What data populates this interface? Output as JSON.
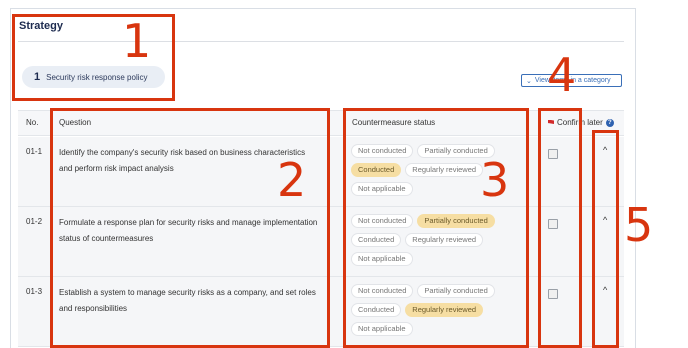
{
  "section": {
    "title": "Strategy"
  },
  "category": {
    "number": "1",
    "name": "Security risk response policy"
  },
  "view_category_button": "View items in a category",
  "table": {
    "headers": {
      "no": "No.",
      "question": "Question",
      "status": "Countermeasure status",
      "confirm": "Confirm later"
    },
    "rows": [
      {
        "no": "01-1",
        "question": "Identify the company's security risk based on business characteristics and perform risk impact analysis",
        "statuses": [
          {
            "label": "Not conducted",
            "selected": false
          },
          {
            "label": "Partially conducted",
            "selected": false
          },
          {
            "label": "Conducted",
            "selected": true
          },
          {
            "label": "Regularly reviewed",
            "selected": false
          },
          {
            "label": "Not applicable",
            "selected": false
          }
        ]
      },
      {
        "no": "01-2",
        "question": "Formulate a response plan for security risks and manage implementation status of countermeasures",
        "statuses": [
          {
            "label": "Not conducted",
            "selected": false
          },
          {
            "label": "Partially conducted",
            "selected": true
          },
          {
            "label": "Conducted",
            "selected": false
          },
          {
            "label": "Regularly reviewed",
            "selected": false
          },
          {
            "label": "Not applicable",
            "selected": false
          }
        ]
      },
      {
        "no": "01-3",
        "question": "Establish a system to manage security risks as a company, and set roles and responsibilities",
        "statuses": [
          {
            "label": "Not conducted",
            "selected": false
          },
          {
            "label": "Partially conducted",
            "selected": false
          },
          {
            "label": "Conducted",
            "selected": false
          },
          {
            "label": "Regularly reviewed",
            "selected": true
          },
          {
            "label": "Not applicable",
            "selected": false
          }
        ]
      }
    ]
  },
  "callouts": [
    "1",
    "2",
    "3",
    "4",
    "5"
  ],
  "colors": {
    "callout": "#d8350f",
    "selected_chip": "#f6dea3",
    "link_blue": "#3a6fb8"
  }
}
